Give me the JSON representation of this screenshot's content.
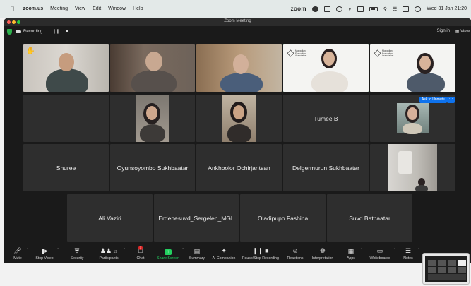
{
  "menubar": {
    "app": "zoom.us",
    "items": [
      "Meeting",
      "View",
      "Edit",
      "Window",
      "Help"
    ],
    "zoom_logo": "zoom",
    "datetime": "Wed 31 Jan 21:20"
  },
  "window": {
    "title": "Zoom Meeting",
    "recording_label": "Recording...",
    "recording_pause": "❙❙",
    "recording_stop": "■",
    "sign_in": "Sign in",
    "view": "View"
  },
  "org_logo": {
    "line1": "Mongolian",
    "line2": "Evaluation",
    "line3": "Association"
  },
  "ask_to_unmute": "Ask to Unmute",
  "more_dots": "···",
  "participants": {
    "tumee": "Tumee B",
    "shuree": "Shuree",
    "oyunsoyombo": "Oyunsoyombo Sukhbaatar",
    "ankhbolor": "Ankhbolor Ochirjantsan",
    "delgermurun": "Delgermurun Sukhbaatar",
    "ali": "Ali Vaziri",
    "erdenesuvd": "Erdenesuvd_Sergelen_MGL",
    "oladipupo": "Oladipupo Fashina",
    "suvd": "Suvd Batbaatar"
  },
  "toolbar": {
    "mute": "Mute",
    "stop_video": "Stop Video",
    "security": "Security",
    "participants": "Participants",
    "participants_count": "19",
    "chat": "Chat",
    "chat_badge": "1",
    "share_screen": "Share Screen",
    "summary": "Summary",
    "ai_companion": "AI Companion",
    "pause_recording": "Pause/Stop Recording",
    "reactions": "Reactions",
    "interpretation": "Interpretation",
    "apps": "Apps",
    "whiteboards": "Whiteboards",
    "notes": "Notes"
  },
  "colors": {
    "active_speaker": "#23d160",
    "ask_button": "#0e72ed",
    "tile": "#2e2e2e",
    "background": "#1a1a1a"
  }
}
